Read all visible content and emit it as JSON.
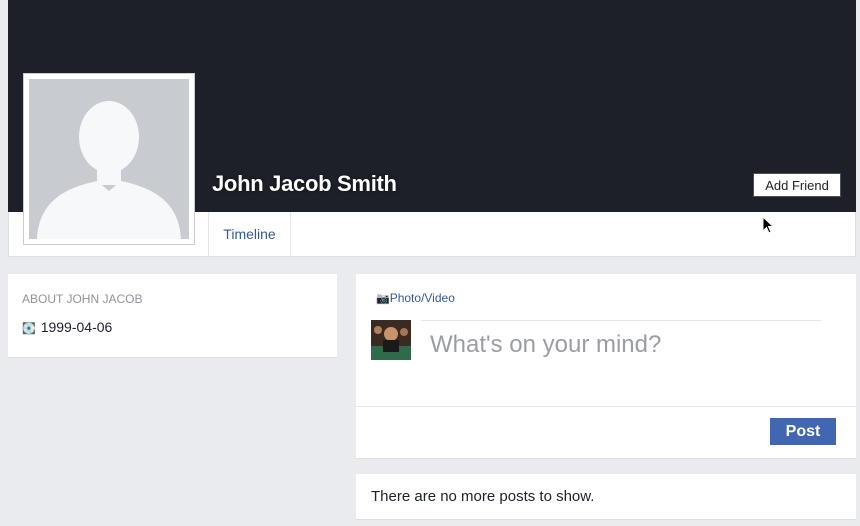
{
  "profile": {
    "name": "John Jacob Smith",
    "add_friend_label": "Add Friend"
  },
  "nav": {
    "tabs": [
      {
        "label": "Timeline"
      }
    ]
  },
  "about": {
    "title": "ABOUT JOHN JACOB",
    "birthday": "1999-04-06",
    "birthday_icon": "cake-icon"
  },
  "composer": {
    "tab_label": "Photo/Video",
    "tab_icon": "camera-icon",
    "placeholder": "What's on your mind?",
    "post_label": "Post"
  },
  "feed": {
    "empty_message": "There are no more posts to show."
  },
  "colors": {
    "cover": "#1d2029",
    "link": "#365899",
    "primary_button": "#4267b2",
    "page_bg": "#e9ebee"
  }
}
